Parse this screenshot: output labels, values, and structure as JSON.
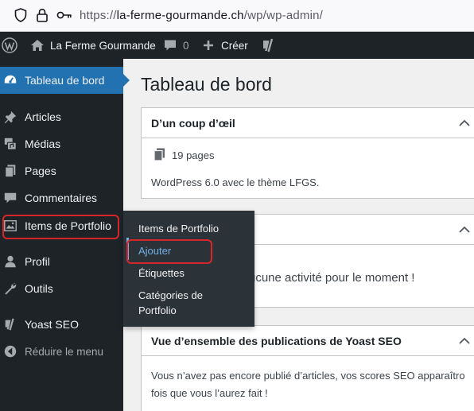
{
  "browser": {
    "url_scheme": "https://",
    "url_host": "la-ferme-gourmande.ch",
    "url_path": "/wp/wp-admin/"
  },
  "adminbar": {
    "site_name": "La Ferme Gourmande",
    "comments_count": "0",
    "new_label": "Créer"
  },
  "sidebar": {
    "items": [
      {
        "label": "Tableau de bord",
        "icon": "dashboard-icon"
      },
      {
        "label": "Articles",
        "icon": "pushpin-icon"
      },
      {
        "label": "Médias",
        "icon": "media-icon"
      },
      {
        "label": "Pages",
        "icon": "pages-icon"
      },
      {
        "label": "Commentaires",
        "icon": "comment-icon"
      },
      {
        "label": "Items de Portfolio",
        "icon": "portfolio-icon"
      },
      {
        "label": "Profil",
        "icon": "user-icon"
      },
      {
        "label": "Outils",
        "icon": "wrench-icon"
      },
      {
        "label": "Yoast SEO",
        "icon": "yoast-icon"
      },
      {
        "label": "Réduire le menu",
        "icon": "collapse-icon"
      }
    ]
  },
  "flyout": {
    "items": [
      "Items de Portfolio",
      "Ajouter",
      "Étiquettes",
      "Catégories de",
      "Portfolio"
    ]
  },
  "main": {
    "title": "Tableau de bord",
    "glance": {
      "title": "D’un coup d’œil",
      "pages_link": "19 pages",
      "footer": "WordPress 6.0 avec le thème LFGS."
    },
    "activity": {
      "text": "ucune activité pour le moment !"
    },
    "yoast": {
      "title": "Vue d’ensemble des publications de Yoast SEO",
      "line1": "Vous n’avez pas encore publié d’articles, vos scores SEO apparaîtro",
      "line2": "fois que vous l’aurez fait !"
    }
  },
  "colors": {
    "admin_bg": "#1d2327",
    "accent": "#2271b1",
    "highlight": "#d7262b",
    "submenu_active": "#72aee6"
  }
}
